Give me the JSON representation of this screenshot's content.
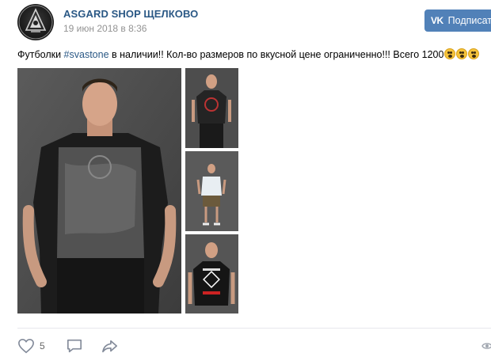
{
  "post": {
    "author": "ASGARD SHOP ЩЕЛКОВО",
    "date": "19 июн 2018 в 8:36",
    "text_before": "Футболки ",
    "hashtag": "#svastone",
    "text_after": " в наличии!! Кол-во размеров по вкусной цене ограниченно!!! Всего 1200",
    "emoji_count": 3
  },
  "header": {
    "subscribe_label": "Подписат",
    "vk_logo": "VK"
  },
  "footer": {
    "like_count": "5"
  },
  "colors": {
    "link": "#2a5885",
    "button": "#5181b8",
    "muted": "#939393",
    "divider": "#e7e8ec"
  },
  "icons": [
    "group-avatar",
    "vk-logo",
    "emoji-icon",
    "heart-icon",
    "comment-icon",
    "share-icon",
    "views-icon"
  ]
}
